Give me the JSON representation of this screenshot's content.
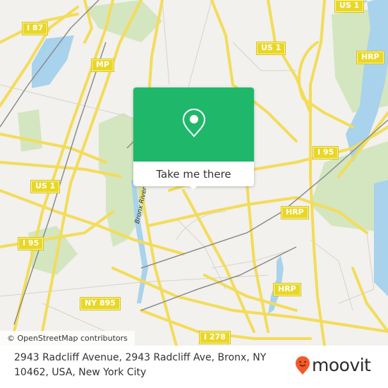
{
  "map": {
    "shields": [
      {
        "id": "i87",
        "label": "I 87"
      },
      {
        "id": "mp",
        "label": "MP"
      },
      {
        "id": "us1-top",
        "label": "US 1"
      },
      {
        "id": "us1-mid",
        "label": "US 1"
      },
      {
        "id": "us1-left",
        "label": "US 1"
      },
      {
        "id": "hrp-top",
        "label": "HRP"
      },
      {
        "id": "i95-right",
        "label": "I 95"
      },
      {
        "id": "hrp-mid",
        "label": "HRP"
      },
      {
        "id": "i95-left",
        "label": "I 95"
      },
      {
        "id": "hrp-low",
        "label": "HRP"
      },
      {
        "id": "ny895",
        "label": "NY 895"
      },
      {
        "id": "i278",
        "label": "I 278"
      }
    ],
    "river_label": "Bronx River",
    "colors": {
      "land": "#f2f1ed",
      "road": "#f7e36b",
      "park": "#cde3b8",
      "water": "#a9d3ec",
      "rail": "#8c8c8c"
    }
  },
  "popup": {
    "action_label": "Take me there",
    "accent_color": "#1fb86a"
  },
  "attribution": "© OpenStreetMap contributors",
  "footer": {
    "address": "2943 Radcliff Avenue, 2943 Radcliff Ave, Bronx, NY 10462, USA, New York City",
    "brand": "moovit",
    "brand_color": "#f15a29"
  }
}
